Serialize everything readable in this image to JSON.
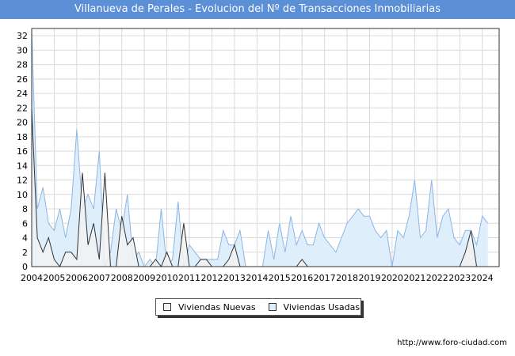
{
  "title": "Villanueva de Perales - Evolucion del Nº de Transacciones Inmobiliarias",
  "footer": "http://www.foro-ciudad.com",
  "colors": {
    "title_bg": "#5b8fd6",
    "nuevas_fill": "#f2f2f2",
    "nuevas_line": "#333333",
    "usadas_fill": "#dfeefb",
    "usadas_line": "#8ab6e6",
    "grid": "#d9d9d9"
  },
  "chart_data": {
    "type": "area",
    "xlim": [
      2004,
      2024.75
    ],
    "ylim": [
      0,
      33
    ],
    "x_tick_labels": [
      "2004",
      "2005",
      "2006",
      "2007",
      "2008",
      "2009",
      "2010",
      "2011",
      "2012",
      "2013",
      "2014",
      "2015",
      "2016",
      "2017",
      "2018",
      "2019",
      "2020",
      "2021",
      "2022",
      "2023",
      "2024"
    ],
    "y_tick_labels": [
      "0",
      "2",
      "4",
      "6",
      "8",
      "10",
      "12",
      "14",
      "16",
      "18",
      "20",
      "22",
      "24",
      "26",
      "28",
      "30",
      "32"
    ],
    "x_start": 2004,
    "x_step": 0.25,
    "series": [
      {
        "name": "Viviendas Nuevas",
        "values": [
          22,
          4,
          2,
          4,
          1,
          0,
          2,
          2,
          1,
          13,
          3,
          6,
          1,
          13,
          0,
          0,
          7,
          3,
          4,
          0,
          0,
          0,
          1,
          0,
          2,
          0,
          0,
          6,
          0,
          0,
          1,
          1,
          0,
          0,
          0,
          1,
          3,
          0,
          0,
          0,
          0,
          0,
          0,
          0,
          0,
          0,
          0,
          0,
          1,
          0,
          0,
          0,
          0,
          0,
          0,
          0,
          0,
          0,
          0,
          0,
          0,
          0,
          0,
          0,
          0,
          0,
          0,
          0,
          0,
          0,
          0,
          0,
          0,
          0,
          0,
          0,
          0,
          2,
          5,
          0,
          0,
          0,
          0
        ]
      },
      {
        "name": "Viviendas Usadas",
        "values": [
          33,
          8,
          11,
          6,
          5,
          8,
          4,
          8,
          19,
          8,
          10,
          8,
          16,
          0,
          2,
          8,
          5,
          10,
          1,
          2,
          0,
          1,
          0,
          8,
          0,
          1,
          9,
          0,
          3,
          2,
          1,
          1,
          1,
          1,
          5,
          3,
          3,
          5,
          0,
          0,
          0,
          0,
          5,
          1,
          6,
          2,
          7,
          3,
          5,
          3,
          3,
          6,
          4,
          3,
          2,
          4,
          6,
          7,
          8,
          7,
          7,
          5,
          4,
          5,
          0,
          5,
          4,
          7,
          12,
          4,
          5,
          12,
          4,
          7,
          8,
          4,
          3,
          5,
          5,
          3,
          7,
          6
        ]
      }
    ]
  }
}
